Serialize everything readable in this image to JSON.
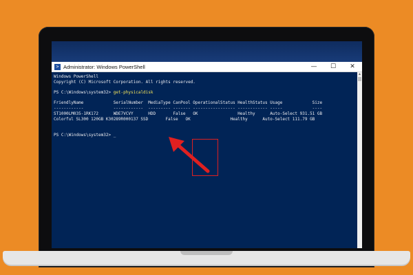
{
  "window": {
    "title": "Administrator: Windows PowerShell",
    "minimize_glyph": "—",
    "maximize_glyph": "☐",
    "close_glyph": "✕",
    "icon": "powershell-icon"
  },
  "console": {
    "lines": [
      {
        "text": "Windows PowerShell"
      },
      {
        "text": "Copyright (C) Microsoft Corporation. All rights reserved."
      },
      {
        "text": ""
      },
      {
        "prompt": "PS C:\\Windows\\system32> ",
        "command": "get-physicaldisk"
      },
      {
        "text": ""
      },
      {
        "text": "FriendlyName            SerialNumber  MediaType CanPool OperationalStatus HealthStatus Usage            Size"
      },
      {
        "text": "------------            ------------  --------- ------- ----------------- ------------ -----            ----"
      },
      {
        "text": "ST1000LM035-1RK172      WDE7VCVY      HDD       False   OK                Healthy      Auto-Select 931.51 GB"
      },
      {
        "text": "Colorful SL300 120GB K30289R000137 SSD       False   OK                Healthy      Auto-Select 111.79 GB"
      },
      {
        "text": ""
      },
      {
        "text": ""
      },
      {
        "prompt": "PS C:\\Windows\\system32> ",
        "command": "",
        "cursor": "_"
      }
    ]
  },
  "table": {
    "columns": [
      "FriendlyName",
      "SerialNumber",
      "MediaType",
      "CanPool",
      "OperationalStatus",
      "HealthStatus",
      "Usage",
      "Size"
    ],
    "rows": [
      [
        "ST1000LM035-1RK172",
        "WDE7VCVY",
        "HDD",
        "False",
        "OK",
        "Healthy",
        "Auto-Select",
        "931.51 GB"
      ],
      [
        "Colorful SL300 120GB",
        "K30289R000137",
        "SSD",
        "False",
        "OK",
        "Healthy",
        "Auto-Select",
        "111.79 GB"
      ]
    ]
  },
  "colors": {
    "background": "#ec8b25",
    "console_bg": "#012456",
    "console_text": "#eeedf0",
    "command_text": "#f5e45b",
    "annotation_red": "#e02020"
  }
}
